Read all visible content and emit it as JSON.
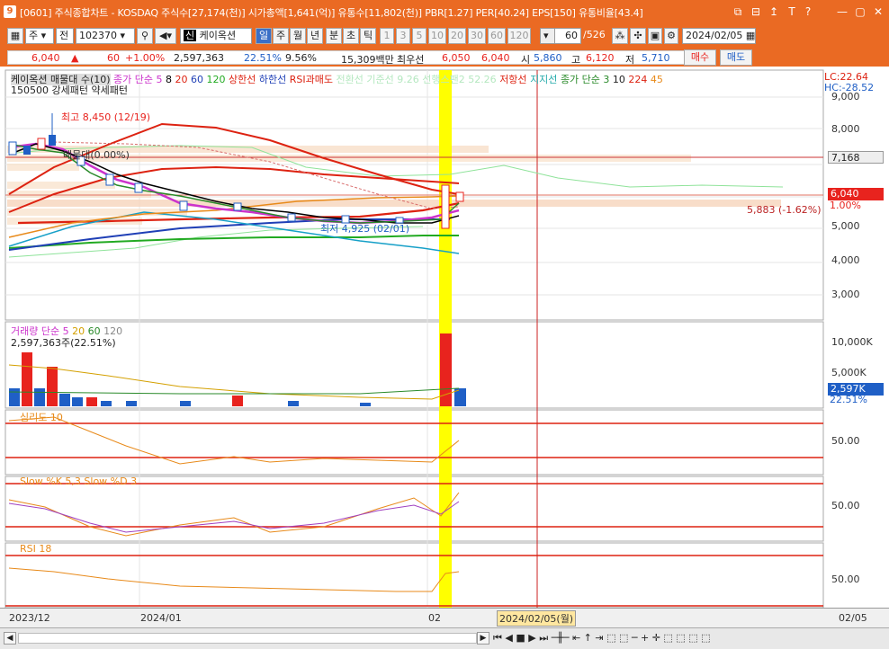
{
  "window": {
    "app_number": "9",
    "title": "[0601] 주식종합차트 - KOSDAQ 주식수[27,174(천)] 시가총액[1,641(억)] 유통수[11,802(천)] PBR[1.27] PER[40.24] EPS[150] 유통비율[43.4]",
    "buttons": [
      "⧉",
      "⊟",
      "↥",
      "T",
      "?",
      "—",
      "▢",
      "✕"
    ]
  },
  "toolbar": {
    "period": "주",
    "range": "전",
    "code": "102370",
    "stock_tag": "신",
    "stock_name": "케이옥션",
    "timeframes": [
      "일",
      "주",
      "월",
      "년",
      "분",
      "초",
      "틱"
    ],
    "active_timeframe": "일",
    "minutes": [
      "1",
      "3",
      "5",
      "10",
      "20",
      "30",
      "60",
      "120"
    ],
    "count_value": "60",
    "count_total": "/526",
    "date": "2024/02/05",
    "buy_label": "매수",
    "sell_label": "매도"
  },
  "quote": {
    "price": "6,040",
    "change": "60",
    "change_pct": "+1.00%",
    "volume": "2,597,363",
    "volume_ratio": "22.51%",
    "turnover": "9.56%",
    "amount": "15,309백만",
    "pref_label": "최우선",
    "ask": "6,050",
    "bid": "6,040",
    "open_label": "시",
    "open": "5,860",
    "high_label": "고",
    "high": "6,120",
    "low_label": "저",
    "low": "5,710"
  },
  "legend_price": {
    "name": "케이옥션 매물대 수(10)",
    "ma_label": "종가 단순",
    "ma_periods": [
      "5",
      "8",
      "20",
      "60",
      "120"
    ],
    "upper": "상한선",
    "lower": "하한선",
    "rsi_over": "RSI과매도",
    "lines_faded": "전환선 기준선 9.26  선행스팬2 52.26",
    "resistance": "저항선",
    "support": "지지선",
    "ma2_label": "종가 단순 3",
    "ma2_periods": [
      "10",
      "224",
      "45"
    ],
    "pattern_line": "150500 강세패턴  약세패턴",
    "high_note": "최고 8,450 (12/19)",
    "low_note": "최저 4,925 (02/01)",
    "level_note": "매물대(0.00%)",
    "lc": "LC:22.64",
    "hc": "HC:-28.52"
  },
  "price_axis": {
    "ticks": [
      "9,000",
      "8,000",
      "7,000",
      "6,000",
      "5,000",
      "4,000",
      "3,000"
    ],
    "marker_7168": "7,168",
    "marker_6040": "6,040",
    "marker_pct": "1.00%",
    "target_note": "5,883 (-1.62%)"
  },
  "volume_panel": {
    "legend": "거래량 단순",
    "periods": [
      "5",
      "20",
      "60",
      "120"
    ],
    "value_note": "2,597,363주(22.51%)",
    "ticks": [
      "10,000K",
      "5,000K"
    ],
    "marker": "2,597K",
    "marker_pct": "22.51%"
  },
  "psy_panel": {
    "legend": "심리도 10",
    "tick": "50.00"
  },
  "stoch_panel": {
    "legend": "Slow %K 5,3  Slow %D 3",
    "tick": "50.00"
  },
  "rsi_panel": {
    "legend": "RSI 18",
    "tick": "50.00"
  },
  "time_axis": {
    "labels": [
      "2023/12",
      "2024/01",
      "02"
    ],
    "cursor_date": "2024/02/05(월)",
    "right_label": "02/05"
  },
  "colors": {
    "orange": "#ea6a23",
    "red": "#e8231e",
    "blue": "#1f5fc6",
    "highlight": "#ffff00"
  }
}
